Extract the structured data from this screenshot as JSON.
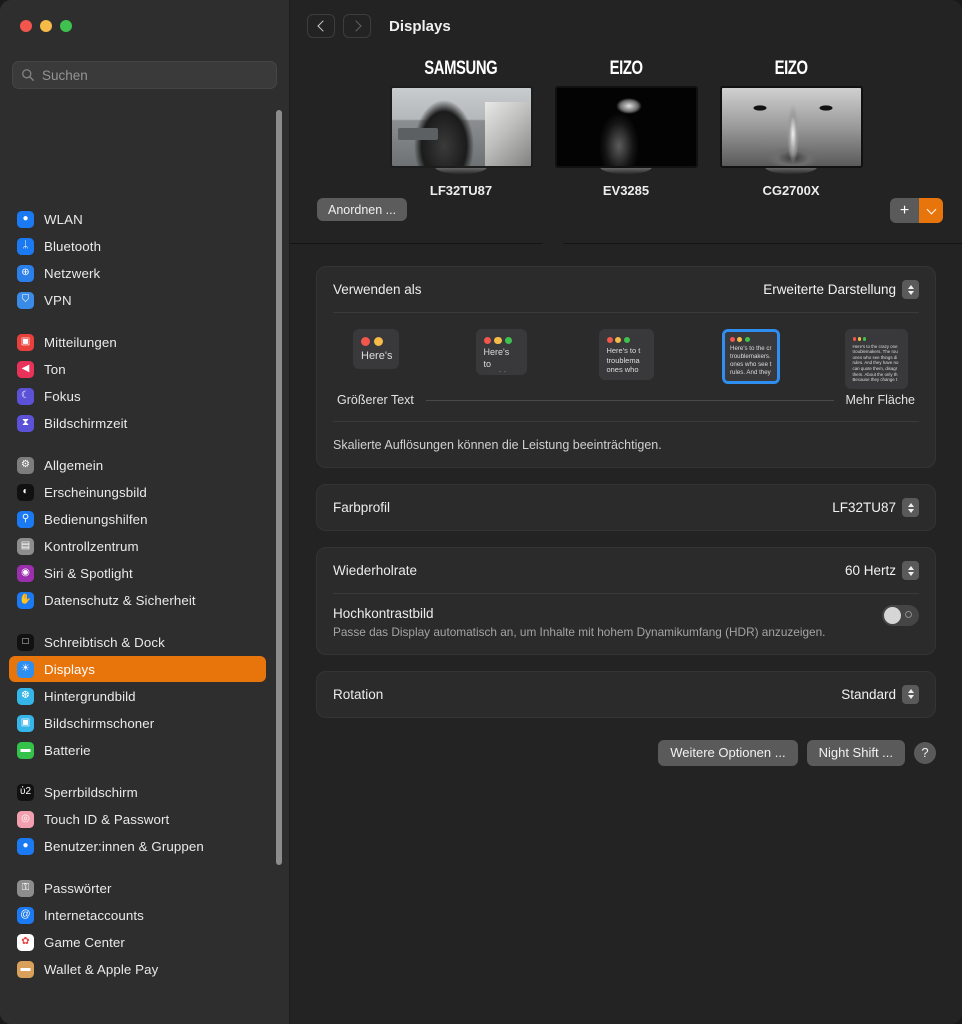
{
  "window": {
    "traffic_lights": [
      "close",
      "minimize",
      "zoom"
    ],
    "colors": {
      "accent": "#e8740c",
      "selection_blue": "#2f8ff0",
      "sidebar_bg": "#2e2e2e",
      "card_bg": "#2b2b2b",
      "page_bg": "#232323"
    }
  },
  "search": {
    "placeholder": "Suchen",
    "value": ""
  },
  "sidebar": {
    "groups": [
      {
        "items": [
          {
            "label": "WLAN",
            "icon": "wifi-icon",
            "color": "#1b79f2",
            "glyph": "●"
          },
          {
            "label": "Bluetooth",
            "icon": "bluetooth-icon",
            "color": "#1b79f2",
            "glyph": "ᛦ"
          },
          {
            "label": "Netzwerk",
            "icon": "globe-icon",
            "color": "#2a7fe8",
            "glyph": "⊕"
          },
          {
            "label": "VPN",
            "icon": "vpn-globe-icon",
            "color": "#3a8ae8",
            "glyph": "⛉"
          }
        ]
      },
      {
        "items": [
          {
            "label": "Mitteilungen",
            "icon": "notifications-icon",
            "color": "#e8413c",
            "glyph": "▣"
          },
          {
            "label": "Ton",
            "icon": "sound-icon",
            "color": "#e8325a",
            "glyph": "◀"
          },
          {
            "label": "Fokus",
            "icon": "focus-moon-icon",
            "color": "#5b52d8",
            "glyph": "☾"
          },
          {
            "label": "Bildschirmzeit",
            "icon": "screen-time-icon",
            "color": "#5b52d8",
            "glyph": "⧗"
          }
        ]
      },
      {
        "items": [
          {
            "label": "Allgemein",
            "icon": "general-gear-icon",
            "color": "#7d7d7d",
            "glyph": "⚙"
          },
          {
            "label": "Erscheinungsbild",
            "icon": "appearance-icon",
            "color": "#111111",
            "glyph": "◐"
          },
          {
            "label": "Bedienungshilfen",
            "icon": "accessibility-icon",
            "color": "#1b79f2",
            "glyph": "⚲"
          },
          {
            "label": "Kontrollzentrum",
            "icon": "control-center-icon",
            "color": "#8d8d8d",
            "glyph": "▤"
          },
          {
            "label": "Siri & Spotlight",
            "icon": "siri-icon",
            "color": "#9b2fae",
            "glyph": "◉"
          },
          {
            "label": "Datenschutz & Sicherheit",
            "icon": "privacy-hand-icon",
            "color": "#1b79f2",
            "glyph": "✋"
          }
        ]
      },
      {
        "items": [
          {
            "label": "Schreibtisch & Dock",
            "icon": "desktop-dock-icon",
            "color": "#111111",
            "glyph": "□"
          },
          {
            "label": "Displays",
            "icon": "displays-icon",
            "color": "#2f8ff0",
            "glyph": "☀",
            "active": true
          },
          {
            "label": "Hintergrundbild",
            "icon": "wallpaper-icon",
            "color": "#35b5e8",
            "glyph": "❆"
          },
          {
            "label": "Bildschirmschoner",
            "icon": "screensaver-icon",
            "color": "#35b5e8",
            "glyph": "▣"
          },
          {
            "label": "Batterie",
            "icon": "battery-icon",
            "color": "#34c24a",
            "glyph": "▬"
          }
        ]
      },
      {
        "items": [
          {
            "label": "Sperrbildschirm",
            "icon": "lock-screen-icon",
            "color": "#111111",
            "glyph": "ὑ2"
          },
          {
            "label": "Touch ID & Passwort",
            "icon": "touch-id-icon",
            "color": "#f2a0b0",
            "glyph": "◎"
          },
          {
            "label": "Benutzer:innen & Gruppen",
            "icon": "users-groups-icon",
            "color": "#1b79f2",
            "glyph": "●"
          }
        ]
      },
      {
        "items": [
          {
            "label": "Passwörter",
            "icon": "passwords-key-icon",
            "color": "#8d8d8d",
            "glyph": "⚿"
          },
          {
            "label": "Internetaccounts",
            "icon": "internet-accounts-icon",
            "color": "#1b79f2",
            "glyph": "@"
          },
          {
            "label": "Game Center",
            "icon": "game-center-icon",
            "color": "#ffffff",
            "glyph": "✿"
          },
          {
            "label": "Wallet & Apple Pay",
            "icon": "wallet-icon",
            "color": "#d8a05a",
            "glyph": "▬"
          }
        ]
      }
    ]
  },
  "toolbar": {
    "back": "back-button",
    "forward": "forward-button",
    "title": "Displays"
  },
  "displays": {
    "arrange_label": "Anordnen ...",
    "add_label": "+",
    "items": [
      {
        "brand": "SAMSUNG",
        "name": "LF32TU87",
        "selected": true
      },
      {
        "brand": "EIZO",
        "name": "EV3285",
        "selected": false
      },
      {
        "brand": "EIZO",
        "name": "CG2700X",
        "selected": false
      }
    ]
  },
  "use_as": {
    "label": "Verwenden als",
    "value": "Erweiterte Darstellung",
    "resolutions": [
      {
        "index": 1,
        "selected": false,
        "preview_text": "Here's",
        "dots": 2,
        "scale": 1.0
      },
      {
        "index": 2,
        "selected": false,
        "preview_text": "Here's to troublem",
        "dots": 3,
        "scale": 0.82
      },
      {
        "index": 3,
        "selected": false,
        "preview_text": "Here's to t troublema ones who",
        "dots": 3,
        "scale": 0.68
      },
      {
        "index": 4,
        "selected": true,
        "preview_text": "Here's to the cr troublemakers. ones who see t rules. And they",
        "dots": 3,
        "scale": 0.56
      },
      {
        "index": 5,
        "selected": false,
        "preview_text": "Here's to the crazy one troublemakers. The rou ones who see things di rules. And they have no can quote them, disagr them. About the only th Because they change t",
        "dots": 3,
        "scale": 0.4
      }
    ],
    "left_label": "Größerer Text",
    "right_label": "Mehr Fläche",
    "note": "Skalierte Auflösungen können die Leistung beeinträchtigen."
  },
  "settings": {
    "color_profile": {
      "label": "Farbprofil",
      "value": "LF32TU87"
    },
    "refresh_rate": {
      "label": "Wiederholrate",
      "value": "60 Hertz"
    },
    "hdr": {
      "label": "Hochkontrastbild",
      "description": "Passe das Display automatisch an, um Inhalte mit hohem Dynamikumfang (HDR) anzuzeigen.",
      "enabled": false
    },
    "rotation": {
      "label": "Rotation",
      "value": "Standard"
    }
  },
  "footer": {
    "more_options": "Weitere Optionen ...",
    "night_shift": "Night Shift ...",
    "help": "?"
  }
}
